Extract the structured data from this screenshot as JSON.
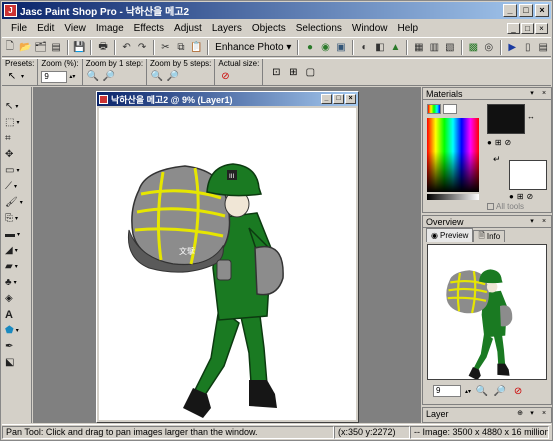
{
  "window": {
    "title": "Jasc Paint Shop Pro - 낙하산을 메고2",
    "app_icon_text": "J",
    "minimize": "_",
    "maximize": "□",
    "close": "×"
  },
  "menu": [
    "File",
    "Edit",
    "View",
    "Image",
    "Effects",
    "Adjust",
    "Layers",
    "Objects",
    "Selections",
    "Window",
    "Help"
  ],
  "toolbar": {
    "enhance_photo_label": "Enhance Photo ▾"
  },
  "tool_options": {
    "presets_label": "Presets:",
    "zoom_label": "Zoom (%):",
    "zoom_value": "9",
    "zoom_by_1_label": "Zoom by 1 step:",
    "zoom_by_5_label": "Zoom by 5 steps:",
    "actual_size_label": "Actual size:"
  },
  "image_window": {
    "title": "낙하산을 메고2 @   9% (Layer1)"
  },
  "artwork": {
    "helmet_text": "III",
    "bag_text": "文擘"
  },
  "materials": {
    "title": "Materials",
    "all_tools_label": "All tools"
  },
  "overview": {
    "title": "Overview",
    "tabs": [
      "Preview",
      "Info"
    ],
    "zoom_value": "9"
  },
  "layer_palette": {
    "title": "Layer"
  },
  "statusbar": {
    "message": "Pan Tool: Click and drag to pan images larger than the window.",
    "coords": "(x:350 y:2272)",
    "image_info": "-- Image:  3500 x 4880 x 16 million"
  },
  "colors": {
    "title_bar_start": "#0a246a",
    "soldier_green": "#1a7a22",
    "parachute_gray": "#8c8c8c",
    "rope_yellow": "#e6e600"
  }
}
